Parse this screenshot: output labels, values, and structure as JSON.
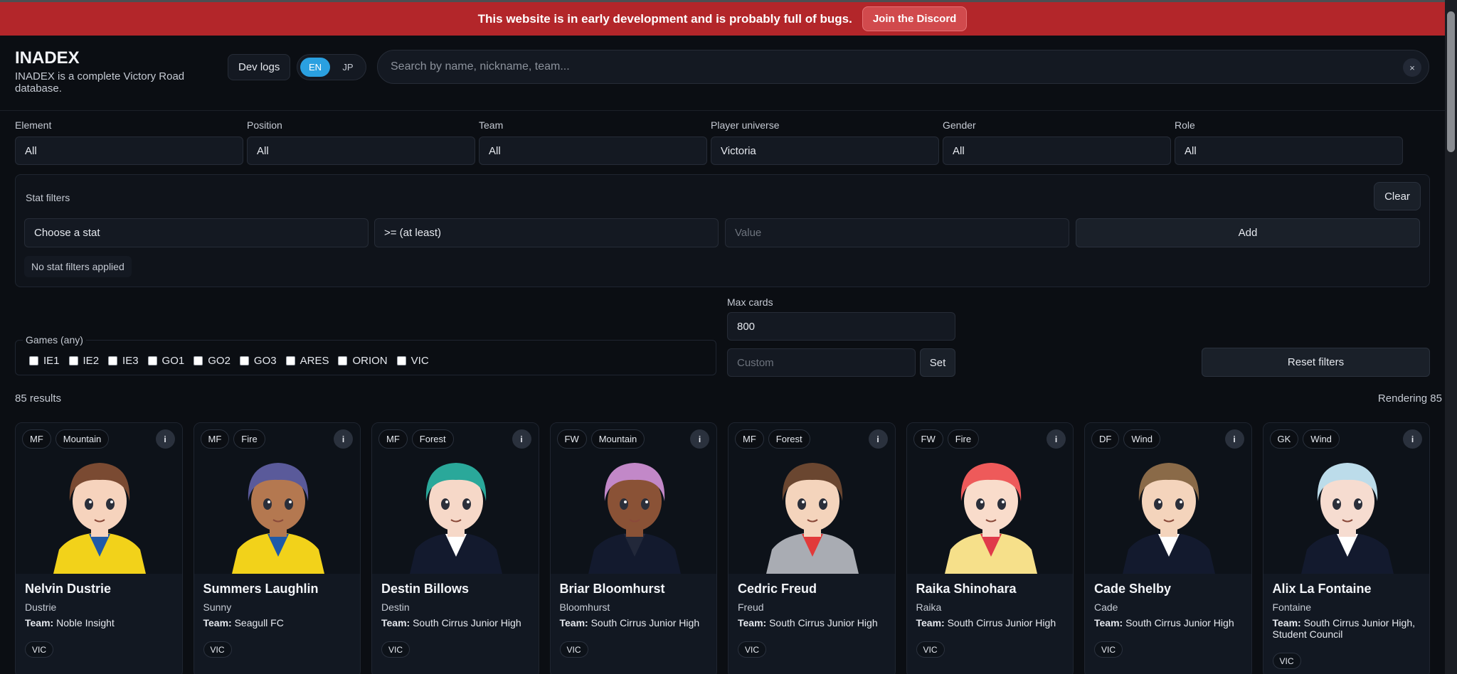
{
  "banner": {
    "text": "This website is in early development and is probably full of bugs.",
    "button": "Join the Discord"
  },
  "header": {
    "title": "INADEX",
    "subtitle": "INADEX is a complete Victory Road database.",
    "devlogs": "Dev logs",
    "lang": {
      "en": "EN",
      "jp": "JP"
    },
    "search_placeholder": "Search by name, nickname, team...",
    "search_clear": "×"
  },
  "filters": [
    {
      "label": "Element",
      "value": "All"
    },
    {
      "label": "Position",
      "value": "All"
    },
    {
      "label": "Team",
      "value": "All"
    },
    {
      "label": "Player universe",
      "value": "Victoria"
    },
    {
      "label": "Gender",
      "value": "All"
    },
    {
      "label": "Role",
      "value": "All"
    }
  ],
  "stats": {
    "title": "Stat filters",
    "clear": "Clear",
    "stat_placeholder": "Choose a stat",
    "operator": ">= (at least)",
    "value_placeholder": "Value",
    "add": "Add",
    "none": "No stat filters applied"
  },
  "games": {
    "legend": "Games (any)",
    "items": [
      "IE1",
      "IE2",
      "IE3",
      "GO1",
      "GO2",
      "GO3",
      "ARES",
      "ORION",
      "VIC"
    ]
  },
  "maxcards": {
    "label": "Max cards",
    "value": "800",
    "custom_placeholder": "Custom",
    "set": "Set"
  },
  "reset": "Reset filters",
  "results": "85 results",
  "rendering": "Rendering 85",
  "colors": {
    "banner": "#b3262a",
    "accent": "#2aa0e0",
    "background": "#0b0e13"
  },
  "cards": [
    {
      "position": "MF",
      "element": "Mountain",
      "name": "Nelvin Dustrie",
      "nickname": "Dustrie",
      "team_label": "Team:",
      "team": "Noble Insight",
      "game": "VIC",
      "hair": "#7a4a32",
      "skin": "#f6d3bd",
      "shirt": "#f2d21a",
      "shirt2": "#1f5aa8"
    },
    {
      "position": "MF",
      "element": "Fire",
      "name": "Summers Laughlin",
      "nickname": "Sunny",
      "team_label": "Team:",
      "team": "Seagull FC",
      "game": "VIC",
      "hair": "#5a5a9a",
      "skin": "#b47850",
      "shirt": "#f2d21a",
      "shirt2": "#1f5aa8"
    },
    {
      "position": "MF",
      "element": "Forest",
      "name": "Destin Billows",
      "nickname": "Destin",
      "team_label": "Team:",
      "team": "South Cirrus Junior High",
      "game": "VIC",
      "hair": "#2aa89a",
      "skin": "#f6d8c8",
      "shirt": "#131a2e",
      "shirt2": "#ffffff"
    },
    {
      "position": "FW",
      "element": "Mountain",
      "name": "Briar Bloomhurst",
      "nickname": "Bloomhurst",
      "team_label": "Team:",
      "team": "South Cirrus Junior High",
      "game": "VIC",
      "hair": "#c288c8",
      "skin": "#8a5236",
      "shirt": "#131a2e",
      "shirt2": "#22283a"
    },
    {
      "position": "MF",
      "element": "Forest",
      "name": "Cedric Freud",
      "nickname": "Freud",
      "team_label": "Team:",
      "team": "South Cirrus Junior High",
      "game": "VIC",
      "hair": "#6a4630",
      "skin": "#f4d4bc",
      "shirt": "#a9acb3",
      "shirt2": "#e23a3a"
    },
    {
      "position": "FW",
      "element": "Fire",
      "name": "Raika Shinohara",
      "nickname": "Raika",
      "team_label": "Team:",
      "team": "South Cirrus Junior High",
      "game": "VIC",
      "hair": "#ee5a5a",
      "skin": "#f9dccb",
      "shirt": "#f6e08a",
      "shirt2": "#e03a4a"
    },
    {
      "position": "DF",
      "element": "Wind",
      "name": "Cade Shelby",
      "nickname": "Cade",
      "team_label": "Team:",
      "team": "South Cirrus Junior High",
      "game": "VIC",
      "hair": "#8a6a48",
      "skin": "#f4d4bc",
      "shirt": "#131a2e",
      "shirt2": "#ffffff"
    },
    {
      "position": "GK",
      "element": "Wind",
      "name": "Alix La Fontaine",
      "nickname": "Fontaine",
      "team_label": "Team:",
      "team": "South Cirrus Junior High, Student Council",
      "game": "VIC",
      "hair": "#bcdcea",
      "skin": "#f6dcd0",
      "shirt": "#131a2e",
      "shirt2": "#ffffff"
    }
  ]
}
